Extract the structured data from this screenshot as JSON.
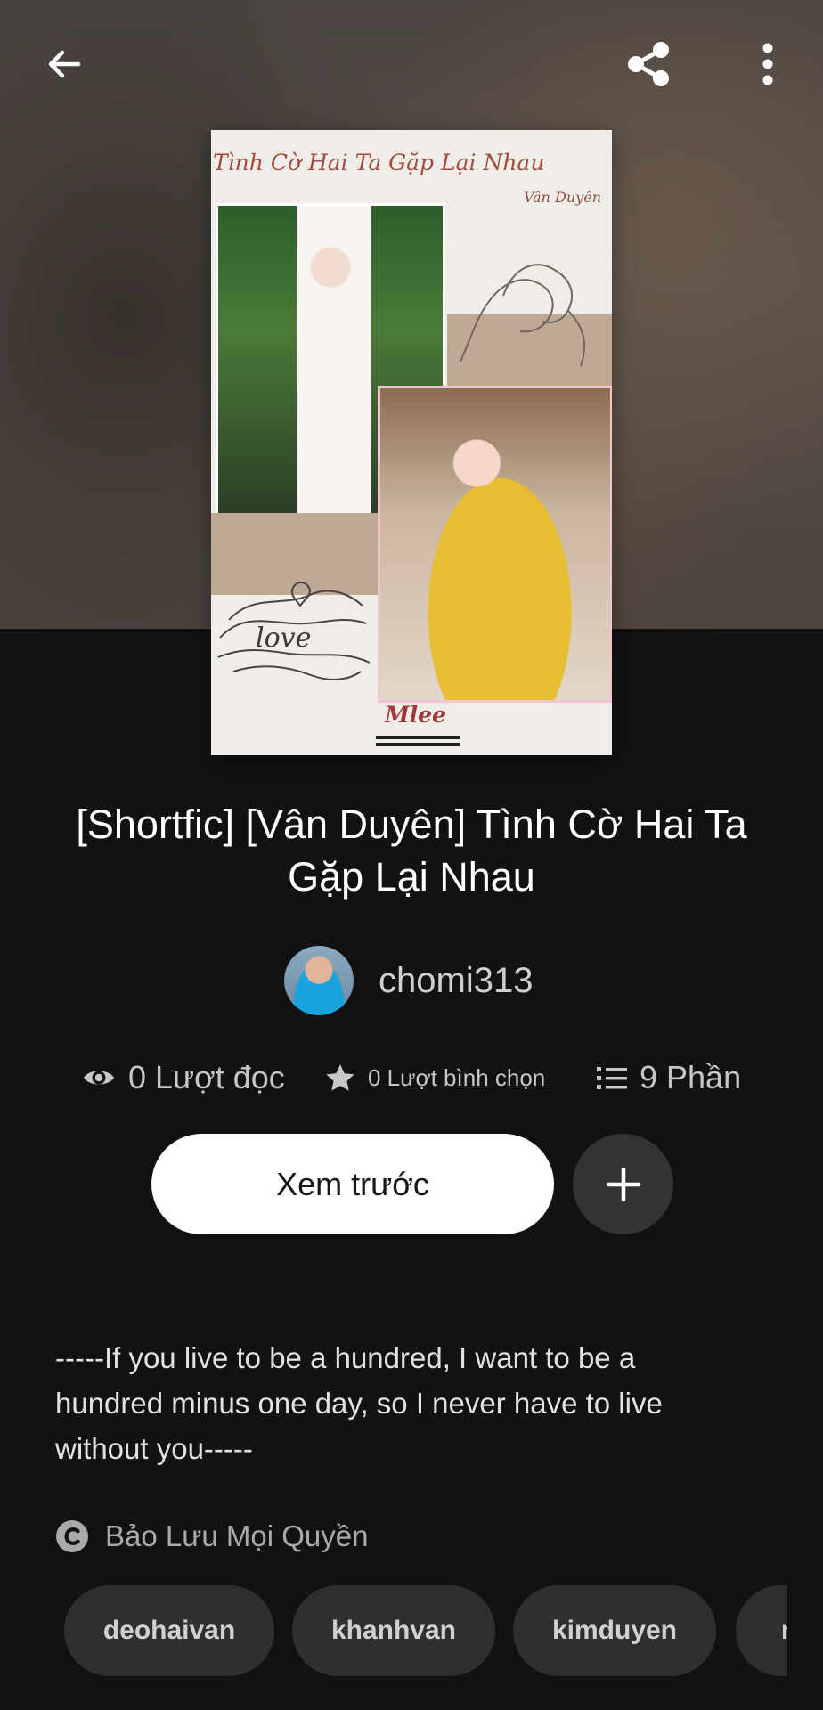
{
  "topbar": {
    "back_icon": "back-arrow-icon",
    "share_icon": "share-icon",
    "more_icon": "more-vertical-icon"
  },
  "cover": {
    "title": "Tình Cờ Hai Ta Gặp Lại Nhau",
    "subtitle": "Vân Duyên",
    "decoration": "love",
    "signature": "Mlee"
  },
  "story": {
    "title": "[Shortfic] [Vân Duyên] Tình Cờ Hai Ta Gặp Lại Nhau"
  },
  "author": {
    "name": "chomi313"
  },
  "stats": {
    "reads_label": "0 Lượt đọc",
    "votes_label": "0 Lượt bình chọn",
    "parts_label": "9 Phần"
  },
  "actions": {
    "preview_label": "Xem trước",
    "add_icon": "plus-icon"
  },
  "description": {
    "text": "-----If you live to be a hundred, I want to be a hundred minus one day, so I never have to live without you-----"
  },
  "copyright": {
    "label": "Bảo Lưu Mọi Quyền",
    "icon": "copyright-icon"
  },
  "tags": [
    "deohaivan",
    "khanhvan",
    "kimduyen",
    "n"
  ],
  "colors": {
    "background": "#121212",
    "button_white": "#ffffff",
    "tag_bg": "#2f2f2f",
    "secondary_text": "#c7c7c7",
    "cover_title": "#a14b3e"
  }
}
